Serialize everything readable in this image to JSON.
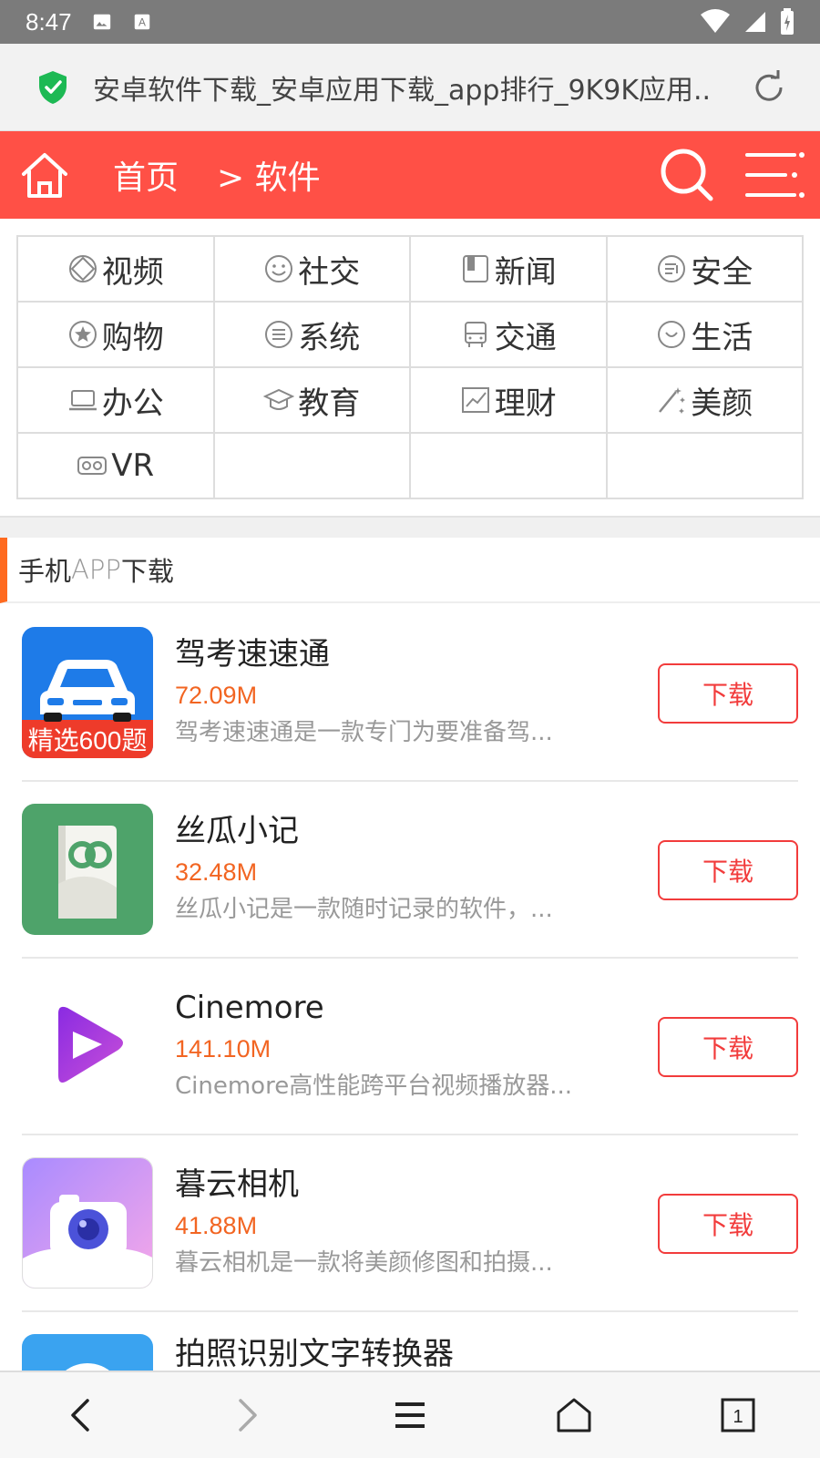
{
  "status_bar": {
    "time": "8:47",
    "icons": [
      "image-icon",
      "a-icon",
      "wifi-icon",
      "signal-icon",
      "battery-icon"
    ]
  },
  "url_bar": {
    "title": "安卓软件下载_安卓应用下载_app排行_9K9K应用..",
    "secure_color": "#1db954"
  },
  "header": {
    "home_label": "首页",
    "crumb_label": "> 软件",
    "bg_color": "#ff5046"
  },
  "categories": [
    {
      "label": "视频",
      "icon": "video-icon"
    },
    {
      "label": "社交",
      "icon": "smile-icon"
    },
    {
      "label": "新闻",
      "icon": "news-icon"
    },
    {
      "label": "安全",
      "icon": "security-icon"
    },
    {
      "label": "购物",
      "icon": "star-icon"
    },
    {
      "label": "系统",
      "icon": "system-icon"
    },
    {
      "label": "交通",
      "icon": "bus-icon"
    },
    {
      "label": "生活",
      "icon": "life-icon"
    },
    {
      "label": "办公",
      "icon": "laptop-icon"
    },
    {
      "label": "教育",
      "icon": "graduation-icon"
    },
    {
      "label": "理财",
      "icon": "chart-icon"
    },
    {
      "label": "美颜",
      "icon": "magic-wand-icon"
    },
    {
      "label": "VR",
      "icon": "vr-icon"
    }
  ],
  "section": {
    "title_prefix": "手机",
    "title_mid": "APP",
    "title_suffix": "下载",
    "accent_color": "#ff6a1f"
  },
  "apps": [
    {
      "name": "驾考速速通",
      "size": "72.09M",
      "desc": "驾考速速通是一款专门为要准备驾...",
      "button": "下载",
      "icon_badge": "精选600题"
    },
    {
      "name": "丝瓜小记",
      "size": "32.48M",
      "desc": "丝瓜小记是一款随时记录的软件，...",
      "button": "下载"
    },
    {
      "name": "Cinemore",
      "size": "141.10M",
      "desc": "Cinemore高性能跨平台视频播放器...",
      "button": "下载"
    },
    {
      "name": "暮云相机",
      "size": "41.88M",
      "desc": "暮云相机是一款将美颜修图和拍摄...",
      "button": "下载"
    },
    {
      "name": "拍照识别文字转换器",
      "size": "",
      "desc": "",
      "button": ""
    }
  ],
  "bottom_nav": {
    "tab_count": "1"
  }
}
